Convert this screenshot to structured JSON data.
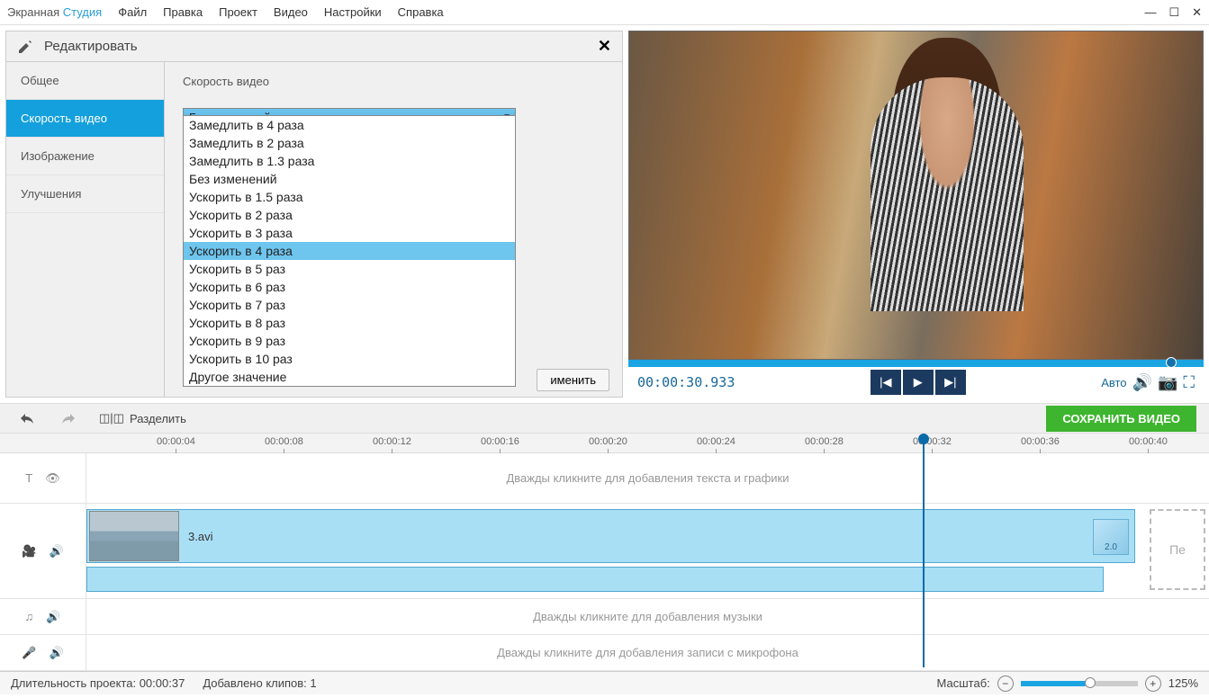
{
  "app": {
    "name1": "Экранная",
    "name2": "Студия"
  },
  "menu": [
    "Файл",
    "Правка",
    "Проект",
    "Видео",
    "Настройки",
    "Справка"
  ],
  "edit": {
    "title": "Редактировать",
    "tabs": [
      "Общее",
      "Скорость видео",
      "Изображение",
      "Улучшения"
    ],
    "field": "Скорость видео",
    "selected": "Без изменений",
    "apply": "именить",
    "options": [
      "Замедлить в 4 раза",
      "Замедлить в 2 раза",
      "Замедлить в 1.3 раза",
      "Без изменений",
      "Ускорить в 1.5 раза",
      "Ускорить в 2 раза",
      "Ускорить в 3 раза",
      "Ускорить в 4 раза",
      "Ускорить в 5 раз",
      "Ускорить в 6 раз",
      "Ускорить в 7 раз",
      "Ускорить в 8 раз",
      "Ускорить в 9 раз",
      "Ускорить в 10 раз",
      "Другое значение"
    ],
    "hover_index": 7
  },
  "player": {
    "time": "00:00:30.933",
    "auto": "Авто"
  },
  "tool": {
    "split": "Разделить",
    "save": "СОХРАНИТЬ ВИДЕО"
  },
  "ruler": [
    "00:00:04",
    "00:00:08",
    "00:00:12",
    "00:00:16",
    "00:00:20",
    "00:00:24",
    "00:00:28",
    "00:00:32",
    "00:00:36",
    "00:00:40"
  ],
  "tracks": {
    "text_hint": "Дважды кликните для добавления текста и графики",
    "music_hint": "Дважды кликните для добавления музыки",
    "mic_hint": "Дважды кликните для добавления записи с микрофона",
    "clip_name": "3.avi",
    "speed_badge": "2.0",
    "drop_hint": "Пе"
  },
  "status": {
    "dur_lbl": "Длительность проекта:",
    "dur_val": "00:00:37",
    "clips_lbl": "Добавлено клипов:",
    "clips_val": "1",
    "zoom_lbl": "Масштаб:",
    "zoom_val": "125%"
  }
}
